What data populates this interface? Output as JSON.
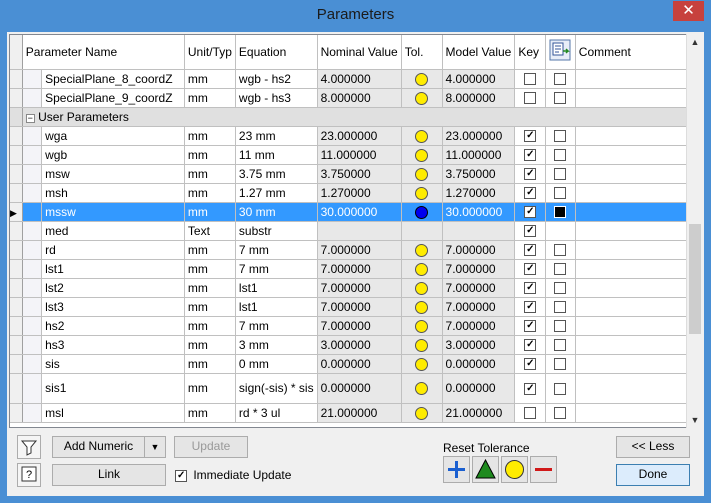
{
  "window": {
    "title": "Parameters",
    "close": "✕"
  },
  "columns": [
    "Parameter Name",
    "Unit/Typ",
    "Equation",
    "Nominal Value",
    "Tol.",
    "Model Value",
    "Key",
    "",
    "Comment"
  ],
  "rows": [
    {
      "type": "param",
      "name": "SpecialPlane_8_coordZ",
      "unit": "mm",
      "eq": "wgb - hs2",
      "nominal": "4.000000",
      "tol": "yellow",
      "model": "4.000000",
      "key": false,
      "export": false
    },
    {
      "type": "param",
      "name": "SpecialPlane_9_coordZ",
      "unit": "mm",
      "eq": "wgb - hs3",
      "nominal": "8.000000",
      "tol": "yellow",
      "model": "8.000000",
      "key": false,
      "export": false
    },
    {
      "type": "group",
      "name": "User Parameters",
      "expander": "−"
    },
    {
      "type": "param",
      "name": "wga",
      "unit": "mm",
      "eq": "23 mm",
      "nominal": "23.000000",
      "tol": "yellow",
      "model": "23.000000",
      "key": true,
      "export": false
    },
    {
      "type": "param",
      "name": "wgb",
      "unit": "mm",
      "eq": "11 mm",
      "nominal": "11.000000",
      "tol": "yellow",
      "model": "11.000000",
      "key": true,
      "export": false
    },
    {
      "type": "param",
      "name": "msw",
      "unit": "mm",
      "eq": "3.75 mm",
      "nominal": "3.750000",
      "tol": "yellow",
      "model": "3.750000",
      "key": true,
      "export": false
    },
    {
      "type": "param",
      "name": "msh",
      "unit": "mm",
      "eq": "1.27 mm",
      "nominal": "1.270000",
      "tol": "yellow",
      "model": "1.270000",
      "key": true,
      "export": false
    },
    {
      "type": "param",
      "name": "mssw",
      "unit": "mm",
      "eq": "30 mm",
      "nominal": "30.000000",
      "tol": "blue",
      "model": "30.000000",
      "key": true,
      "export": "black",
      "selected": true
    },
    {
      "type": "param",
      "name": "med",
      "unit": "Text",
      "eq": "substr",
      "nominal": "",
      "tol": "",
      "model": "",
      "key": true,
      "export": null
    },
    {
      "type": "param",
      "name": "rd",
      "unit": "mm",
      "eq": "7 mm",
      "nominal": "7.000000",
      "tol": "yellow",
      "model": "7.000000",
      "key": true,
      "export": false
    },
    {
      "type": "param",
      "name": "lst1",
      "unit": "mm",
      "eq": "7 mm",
      "nominal": "7.000000",
      "tol": "yellow",
      "model": "7.000000",
      "key": true,
      "export": false
    },
    {
      "type": "param",
      "name": "lst2",
      "unit": "mm",
      "eq": "lst1",
      "nominal": "7.000000",
      "tol": "yellow",
      "model": "7.000000",
      "key": true,
      "export": false
    },
    {
      "type": "param",
      "name": "lst3",
      "unit": "mm",
      "eq": "lst1",
      "nominal": "7.000000",
      "tol": "yellow",
      "model": "7.000000",
      "key": true,
      "export": false
    },
    {
      "type": "param",
      "name": "hs2",
      "unit": "mm",
      "eq": "7 mm",
      "nominal": "7.000000",
      "tol": "yellow",
      "model": "7.000000",
      "key": true,
      "export": false
    },
    {
      "type": "param",
      "name": "hs3",
      "unit": "mm",
      "eq": "3 mm",
      "nominal": "3.000000",
      "tol": "yellow",
      "model": "3.000000",
      "key": true,
      "export": false
    },
    {
      "type": "param",
      "name": "sis",
      "unit": "mm",
      "eq": "0 mm",
      "nominal": "0.000000",
      "tol": "yellow",
      "model": "0.000000",
      "key": true,
      "export": false
    },
    {
      "type": "param",
      "name": "sis1",
      "unit": "mm",
      "eq": "sign(-sis) * sis",
      "nominal": "0.000000",
      "tol": "yellow",
      "model": "0.000000",
      "key": true,
      "export": false,
      "tall": true
    },
    {
      "type": "param",
      "name": "msl",
      "unit": "mm",
      "eq": "rd * 3 ul",
      "nominal": "21.000000",
      "tol": "yellow",
      "model": "21.000000",
      "key": false,
      "export": false
    }
  ],
  "bottom": {
    "add_numeric": "Add Numeric",
    "dropdown": "▼",
    "update": "Update",
    "link": "Link",
    "immediate_update": "Immediate Update",
    "immediate_checked": true,
    "reset_tolerance": "Reset Tolerance",
    "less": "<< Less",
    "done": "Done",
    "filter_icon": "funnel",
    "help_icon": "?"
  },
  "colors": {
    "accent": "#3399ff",
    "titlebar": "#4a8fd4",
    "close": "#c7413d"
  }
}
